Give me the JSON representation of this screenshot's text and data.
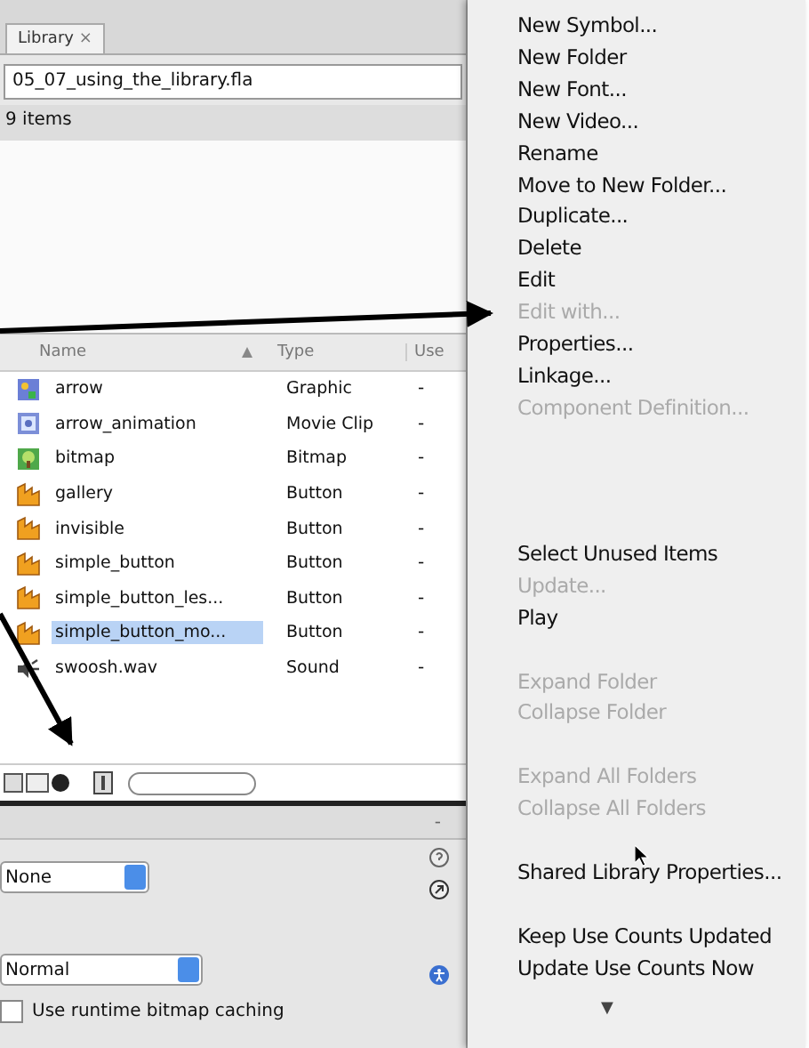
{
  "library": {
    "tab": {
      "label": "Library",
      "close": "×"
    },
    "file": "05_07_using_the_library.fla",
    "count": "9 items",
    "columns": [
      "Name",
      "Type",
      "Use"
    ],
    "rows": [
      {
        "name": "arrow",
        "type": "Graphic",
        "use": "-",
        "kind": "graphic",
        "selected": false
      },
      {
        "name": "arrow_animation",
        "type": "Movie Clip",
        "use": "-",
        "kind": "movie_clip",
        "selected": false
      },
      {
        "name": "bitmap",
        "type": "Bitmap",
        "use": "-",
        "kind": "bitmap",
        "selected": false
      },
      {
        "name": "gallery",
        "type": "Button",
        "use": "-",
        "kind": "button",
        "selected": false
      },
      {
        "name": "invisible",
        "type": "Button",
        "use": "-",
        "kind": "button",
        "selected": false
      },
      {
        "name": "simple_button",
        "type": "Button",
        "use": "-",
        "kind": "button",
        "selected": false
      },
      {
        "name": "simple_button_les...",
        "type": "Button",
        "use": "-",
        "kind": "button",
        "selected": false
      },
      {
        "name": "simple_button_mo...",
        "type": "Button",
        "use": "-",
        "kind": "button",
        "selected": true
      },
      {
        "name": "swoosh.wav",
        "type": "Sound",
        "use": "-",
        "kind": "sound",
        "selected": false
      }
    ]
  },
  "properties": {
    "collapse": "-",
    "selects": [
      "None",
      "Normal"
    ],
    "checkbox": {
      "label": "Use runtime bitmap caching",
      "checked": false
    }
  },
  "menu": {
    "groups": [
      [
        {
          "label": "New Symbol...",
          "disabled": false
        },
        {
          "label": "New Folder",
          "disabled": false
        },
        {
          "label": "New Font...",
          "disabled": false
        },
        {
          "label": "New Video...",
          "disabled": false
        },
        {
          "label": "Rename",
          "disabled": false
        },
        {
          "label": "Move to New Folder...",
          "disabled": false
        },
        {
          "label": "Duplicate...",
          "disabled": false
        },
        {
          "label": "Delete",
          "disabled": false
        },
        {
          "label": "Edit",
          "disabled": false
        },
        {
          "label": "Edit with...",
          "disabled": true
        },
        {
          "label": "Properties...",
          "disabled": false
        },
        {
          "label": "Linkage...",
          "disabled": false
        },
        {
          "label": "Component Definition...",
          "disabled": true
        }
      ],
      [
        {
          "label": "Select Unused Items",
          "disabled": false
        },
        {
          "label": "Update...",
          "disabled": true
        },
        {
          "label": "Play",
          "disabled": false
        }
      ],
      [
        {
          "label": "Expand Folder",
          "disabled": true
        },
        {
          "label": "Collapse Folder",
          "disabled": true
        }
      ],
      [
        {
          "label": "Expand All Folders",
          "disabled": true
        },
        {
          "label": "Collapse All Folders",
          "disabled": true
        }
      ],
      [
        {
          "label": "Shared Library Properties...",
          "disabled": false
        }
      ],
      [
        {
          "label": "Keep Use Counts Updated",
          "disabled": false
        },
        {
          "label": "Update Use Counts Now",
          "disabled": false
        }
      ]
    ],
    "scroll": "▼"
  }
}
